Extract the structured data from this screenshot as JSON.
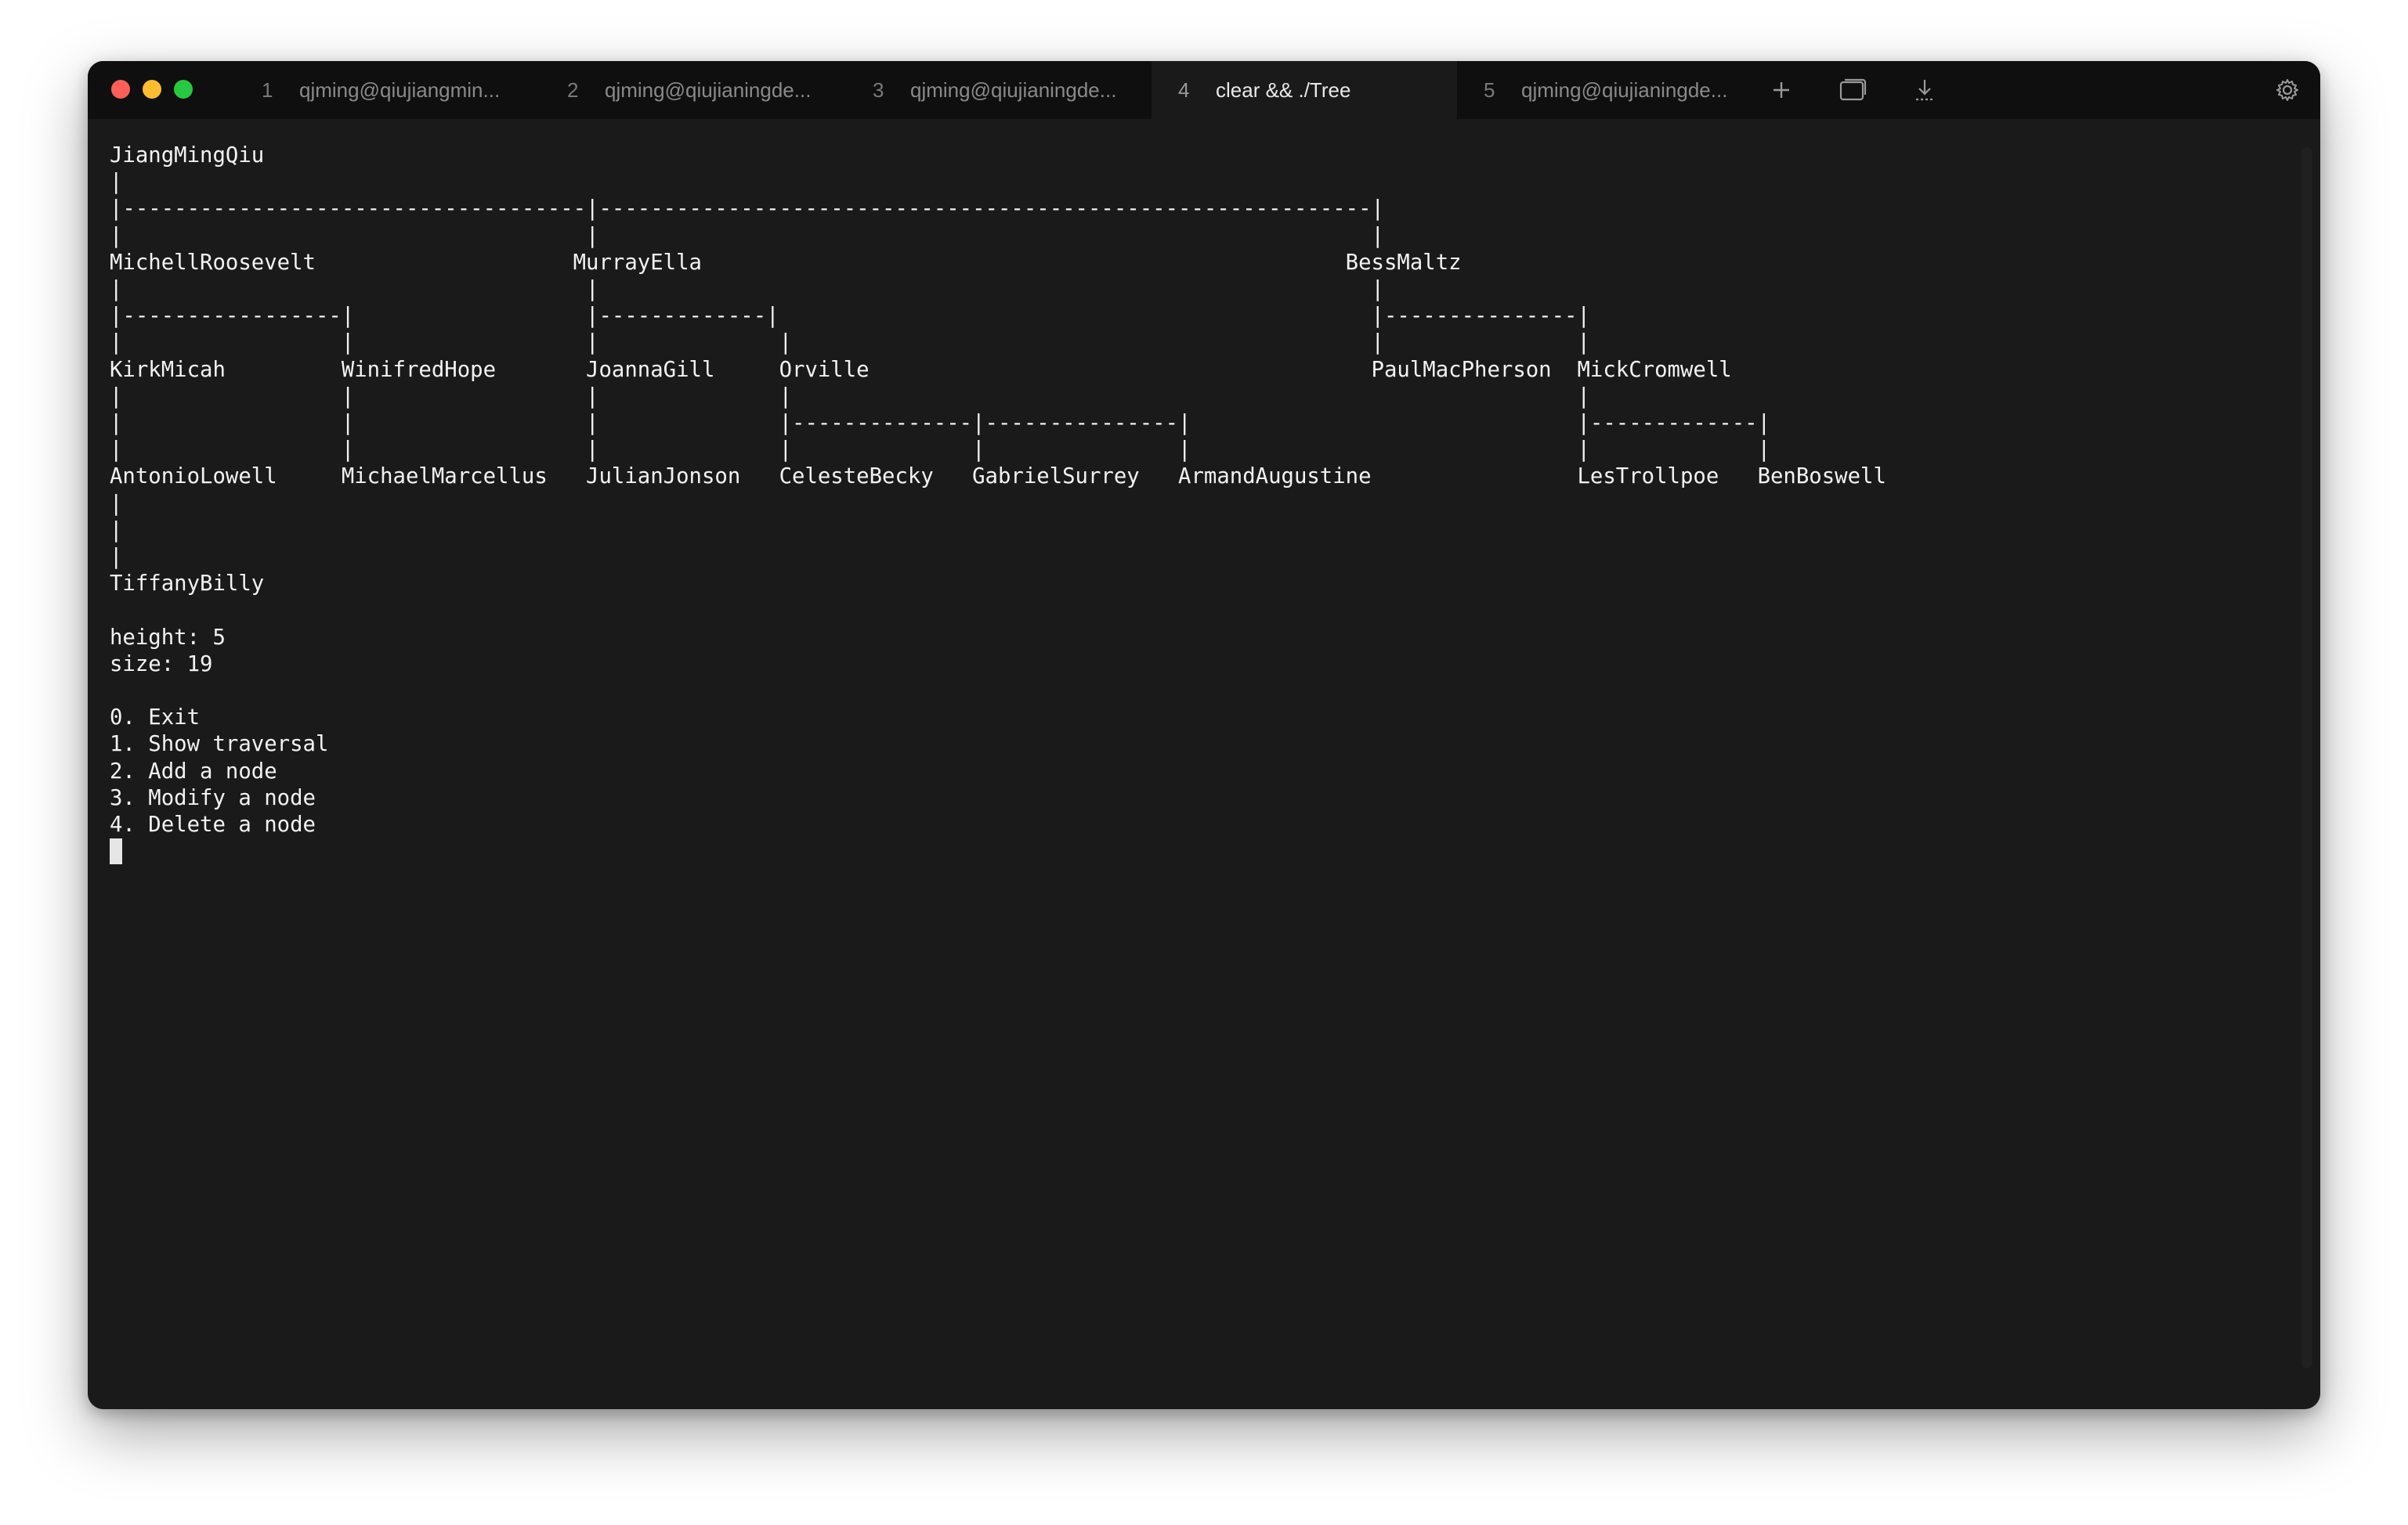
{
  "window": {
    "colors": {
      "close": "#ff5f57",
      "minimize": "#febc2e",
      "zoom": "#28c840",
      "background": "#1a1a1a",
      "tabbar": "#0f0f0f"
    }
  },
  "tabs": [
    {
      "num": "1",
      "title": "qjming@qiujiangmin..."
    },
    {
      "num": "2",
      "title": "qjming@qiujianingde..."
    },
    {
      "num": "3",
      "title": "qjming@qiujianingde..."
    },
    {
      "num": "4",
      "title": "clear && ./Tree",
      "active": true
    },
    {
      "num": "5",
      "title": "qjming@qiujianingde..."
    }
  ],
  "toolbar_icons": [
    "plus-icon",
    "window-icon",
    "download-icon",
    "gear-icon",
    "gift-icon"
  ],
  "terminal": {
    "lines": [
      "JiangMingQiu",
      "|",
      "|------------------------------------|------------------------------------------------------------|",
      "|                                    |                                                            |",
      "MichellRoosevelt                    MurrayElla                                                  BessMaltz",
      "|                                    |                                                            |",
      "|-----------------|                  |-------------|                                              |---------------|",
      "|                 |                  |              |                                             |               |",
      "KirkMicah         WinifredHope       JoannaGill     Orville                                       PaulMacPherson  MickCromwell",
      "|                 |                  |              |                                                             |",
      "|                 |                  |              |--------------|---------------|                              |-------------|",
      "|                 |                  |              |              |               |                              |             |",
      "AntonioLowell     MichaelMarcellus   JulianJonson   CelesteBecky   GabrielSurrey   ArmandAugustine                LesTrollpoe   BenBoswell",
      "|",
      "|",
      "|",
      "TiffanyBilly",
      "",
      "height: 5",
      "size: 19",
      "",
      "0. Exit",
      "1. Show traversal",
      "2. Add a node",
      "3. Modify a node",
      "4. Delete a node"
    ]
  }
}
